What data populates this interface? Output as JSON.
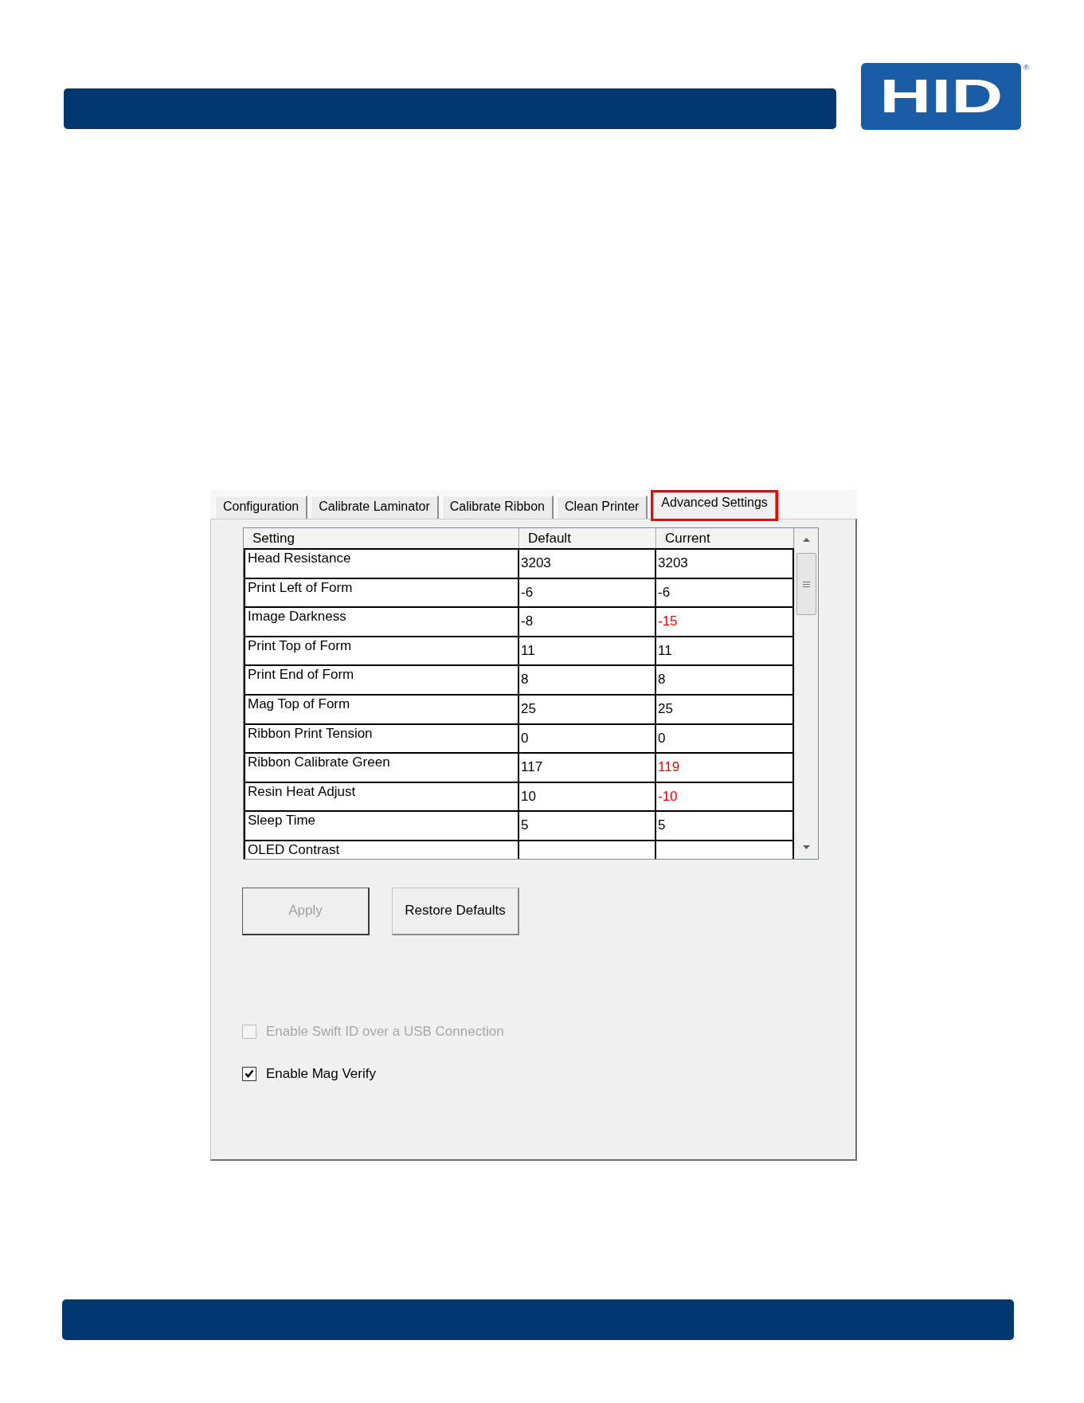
{
  "header": {
    "logo": "HID",
    "registered_mark": "®"
  },
  "dialog": {
    "tabs": [
      {
        "label": "Configuration",
        "selected": false,
        "highlighted": false
      },
      {
        "label": "Calibrate Laminator",
        "selected": false,
        "highlighted": false
      },
      {
        "label": "Calibrate Ribbon",
        "selected": false,
        "highlighted": false
      },
      {
        "label": "Clean Printer",
        "selected": false,
        "highlighted": false
      },
      {
        "label": "Advanced Settings",
        "selected": true,
        "highlighted": true
      }
    ],
    "table": {
      "columns": [
        "Setting",
        "Default",
        "Current"
      ],
      "rows": [
        {
          "kind": "full",
          "setting": "Head Resistance",
          "default": "3203",
          "current": "3203",
          "modified": false
        },
        {
          "kind": "full",
          "setting": "Print Left of Form",
          "default": "-6",
          "current": "-6",
          "modified": false
        },
        {
          "kind": "full",
          "setting": "Image Darkness",
          "default": "-8",
          "current": "-15",
          "modified": true
        },
        {
          "kind": "full",
          "setting": "Print Top of Form",
          "default": "11",
          "current": "11",
          "modified": false
        },
        {
          "kind": "full",
          "setting": "Print End of Form",
          "default": "8",
          "current": "8",
          "modified": false
        },
        {
          "kind": "full",
          "setting": "Mag Top of Form",
          "default": "25",
          "current": "25",
          "modified": false
        },
        {
          "kind": "full",
          "setting": "Ribbon Print Tension",
          "default": "0",
          "current": "0",
          "modified": false
        },
        {
          "kind": "full",
          "setting": "Ribbon Calibrate Green",
          "default": "117",
          "current": "119",
          "modified": true
        },
        {
          "kind": "full",
          "setting": "Resin Heat Adjust",
          "default": "10",
          "current": "-10",
          "modified": true
        },
        {
          "kind": "full",
          "setting": "Sleep Time",
          "default": "5",
          "current": "5",
          "modified": false
        },
        {
          "kind": "partial",
          "setting": "OLED Contrast"
        }
      ]
    },
    "buttons": [
      {
        "label": "Apply",
        "disabled": true,
        "default": true
      },
      {
        "label": "Restore Defaults",
        "disabled": false,
        "default": false
      }
    ],
    "checkboxes": [
      {
        "label": "Enable Swift ID over a USB Connection",
        "checked": false,
        "disabled": true
      },
      {
        "label": "Enable Mag Verify",
        "checked": true,
        "disabled": false
      }
    ]
  }
}
